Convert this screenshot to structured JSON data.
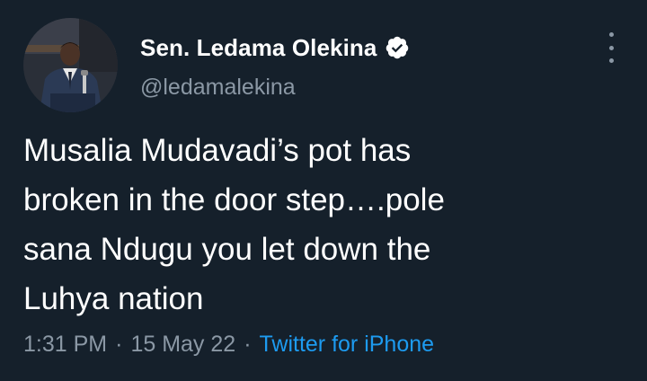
{
  "author": {
    "display_name": "Sen. Ledama Olekina",
    "handle": "@ledamalekina",
    "verified_icon": "verified-badge-icon",
    "avatar_icon": "profile-photo"
  },
  "tweet": {
    "text": "Musalia Mudavadi’s  pot has\nbroken in the door step….pole\nsana Ndugu  you let down the\nLuhya nation"
  },
  "meta": {
    "time": "1:31 PM",
    "separator": "·",
    "date": "15 May 22",
    "source": "Twitter for iPhone"
  },
  "menu": {
    "icon": "more-options-icon"
  },
  "colors": {
    "background": "#15202b",
    "text_primary": "#ffffff",
    "text_secondary": "#8b98a5",
    "accent": "#1d9bf0"
  }
}
